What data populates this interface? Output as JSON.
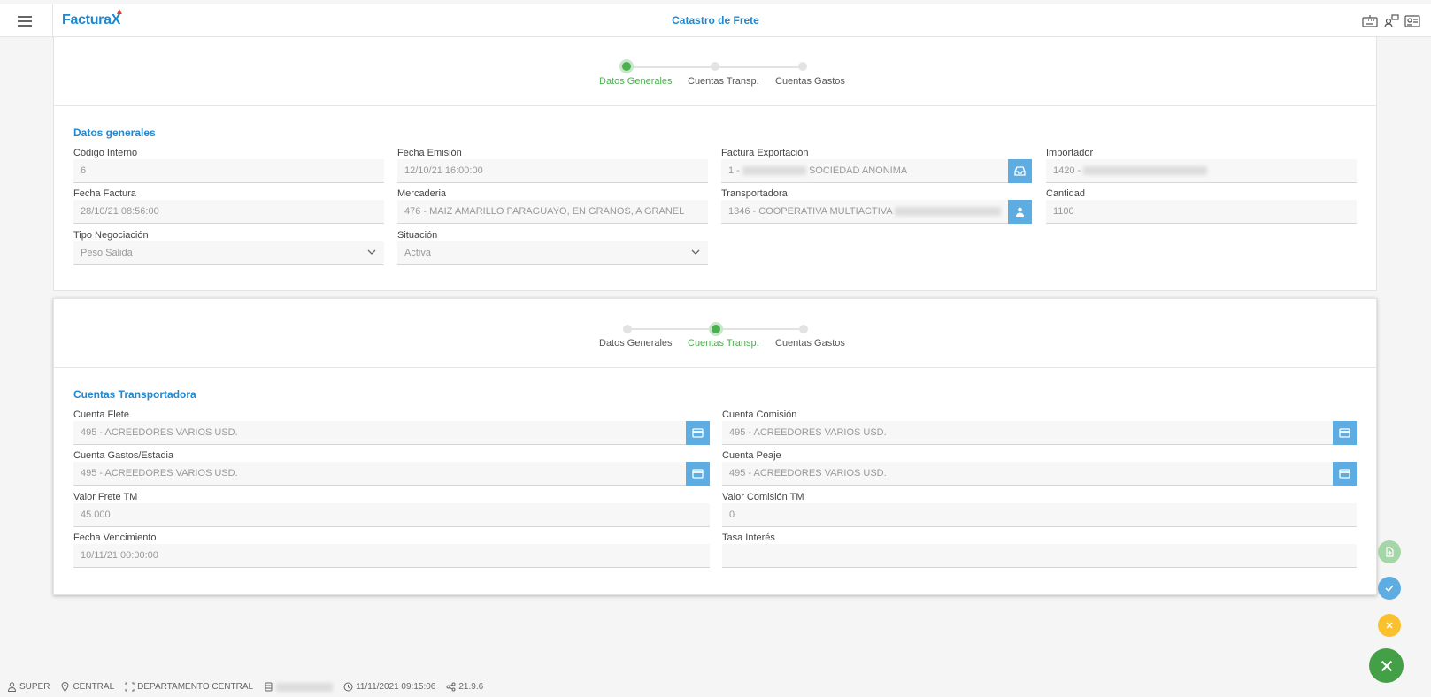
{
  "app": {
    "logo": "Factura",
    "logo_accent": "X",
    "page_title": "Catastro de Frete"
  },
  "steps": [
    "Datos Generales",
    "Cuentas Transp.",
    "Cuentas Gastos"
  ],
  "general": {
    "section_title": "Datos generales",
    "codigo_interno": {
      "label": "Código Interno",
      "value": "6"
    },
    "fecha_emision": {
      "label": "Fecha Emisión",
      "value": "12/10/21 16:00:00"
    },
    "factura_exportacion": {
      "label": "Factura Exportación",
      "value_prefix": "1 -",
      "value_suffix": "SOCIEDAD ANONIMA"
    },
    "importador": {
      "label": "Importador",
      "value_prefix": "1420 -"
    },
    "fecha_factura": {
      "label": "Fecha Factura",
      "value": "28/10/21 08:56:00"
    },
    "mercaderia": {
      "label": "Mercaderia",
      "value": "476 -  MAIZ AMARILLO PARAGUAYO, EN GRANOS, A GRANEL"
    },
    "transportadora": {
      "label": "Transportadora",
      "value_prefix": "1346 - COOPERATIVA MULTIACTIVA"
    },
    "cantidad": {
      "label": "Cantidad",
      "value": "1100"
    },
    "tipo_negociacion": {
      "label": "Tipo Negociación",
      "value": "Peso Salida"
    },
    "situacion": {
      "label": "Situación",
      "value": "Activa"
    }
  },
  "transp": {
    "section_title": "Cuentas Transportadora",
    "cuenta_flete": {
      "label": "Cuenta Flete",
      "value": "495 - ACREEDORES VARIOS USD."
    },
    "cuenta_comision": {
      "label": "Cuenta Comisión",
      "value": "495 - ACREEDORES VARIOS USD."
    },
    "cuenta_gastos": {
      "label": "Cuenta Gastos/Estadia",
      "value": "495 - ACREEDORES VARIOS USD."
    },
    "cuenta_peaje": {
      "label": "Cuenta Peaje",
      "value": "495 - ACREEDORES VARIOS USD."
    },
    "valor_frete": {
      "label": "Valor Frete TM",
      "value": "45.000"
    },
    "valor_comision": {
      "label": "Valor Comisión TM",
      "value": "0"
    },
    "fecha_vencimiento": {
      "label": "Fecha Vencimiento",
      "value": "10/11/21 00:00:00"
    },
    "tasa_interes": {
      "label": "Tasa Interés",
      "value": ""
    }
  },
  "status": {
    "user": "SUPER",
    "location": "CENTRAL",
    "department": "DEPARTAMENTO CENTRAL",
    "datetime": "11/11/2021 09:15:06",
    "version": "21.9.6"
  },
  "colors": {
    "accent": "#1e88d0",
    "success": "#4caf50",
    "button": "#5dade2",
    "warning": "#fbc02d"
  }
}
